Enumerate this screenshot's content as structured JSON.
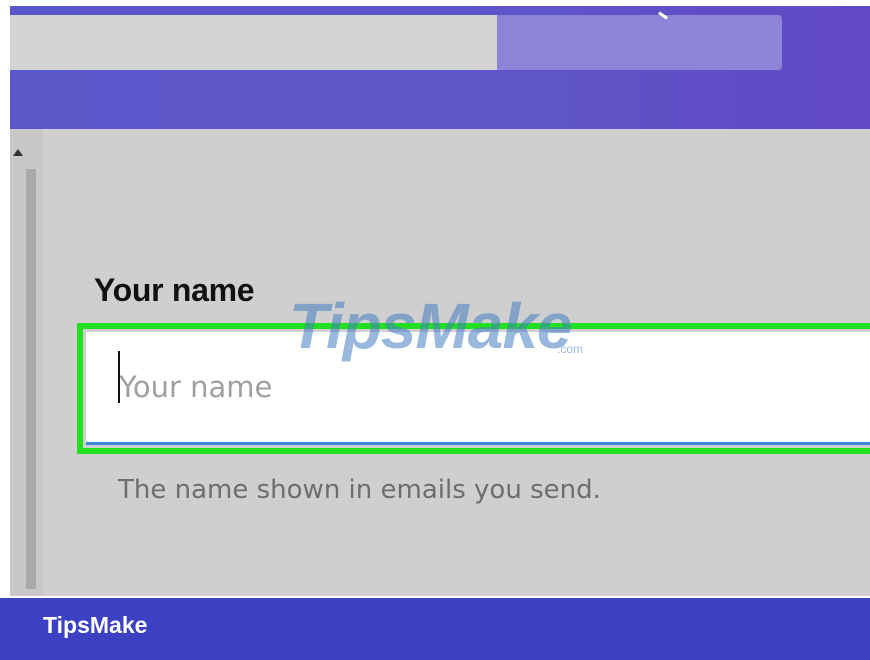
{
  "form": {
    "name_label": "Your name",
    "name_placeholder": "Your name",
    "name_value": "",
    "helper_text": "The name shown in emails you send."
  },
  "watermark": {
    "text": "TipsMake",
    "suffix": ".com"
  },
  "footer": {
    "brand": "TipsMake"
  },
  "colors": {
    "header": "#5a57c9",
    "highlight": "#22e020",
    "input_underline": "#3a8ad8",
    "footer": "#3b41c2"
  }
}
